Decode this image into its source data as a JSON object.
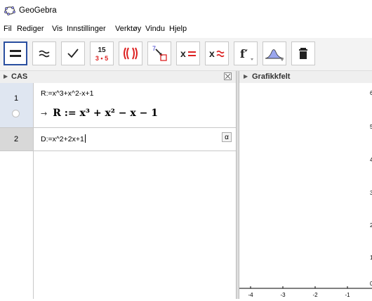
{
  "window": {
    "title": "GeoGebra"
  },
  "menu": [
    "Fil",
    "Rediger",
    "Vis",
    "Innstillinger",
    "Verktøy",
    "Vindu",
    "Hjelp"
  ],
  "toolbar": {
    "tools": [
      {
        "name": "evaluate-tool",
        "glyph": "="
      },
      {
        "name": "numeric-tool",
        "glyph": "≈"
      },
      {
        "name": "keep-input-tool",
        "glyph": "✓"
      },
      {
        "name": "factor-tool",
        "top": "15",
        "bottom": "3 • 5"
      },
      {
        "name": "expand-tool",
        "glyph": "(( ))"
      },
      {
        "name": "substitute-tool"
      },
      {
        "name": "solve-tool",
        "glyph": "x ="
      },
      {
        "name": "solve-numeric-tool",
        "glyph": "x ≈"
      },
      {
        "name": "derivative-tool",
        "glyph": "f′"
      },
      {
        "name": "probability-tool"
      },
      {
        "name": "delete-tool"
      }
    ]
  },
  "cas": {
    "title": "CAS",
    "rows": [
      {
        "num": "1",
        "input": "R:=x^3+x^2-x+1",
        "output_arrow": "→",
        "output": "R := x³ + x² − x − 1"
      },
      {
        "num": "2",
        "input": "D:=x^2+2x+1",
        "alpha": "α"
      }
    ]
  },
  "graphics": {
    "title": "Grafikkfelt",
    "x_ticks": [
      "-4",
      "-3",
      "-2",
      "-1"
    ],
    "y_ticks": [
      "6",
      "5",
      "4",
      "3",
      "2",
      "1",
      "0"
    ]
  }
}
